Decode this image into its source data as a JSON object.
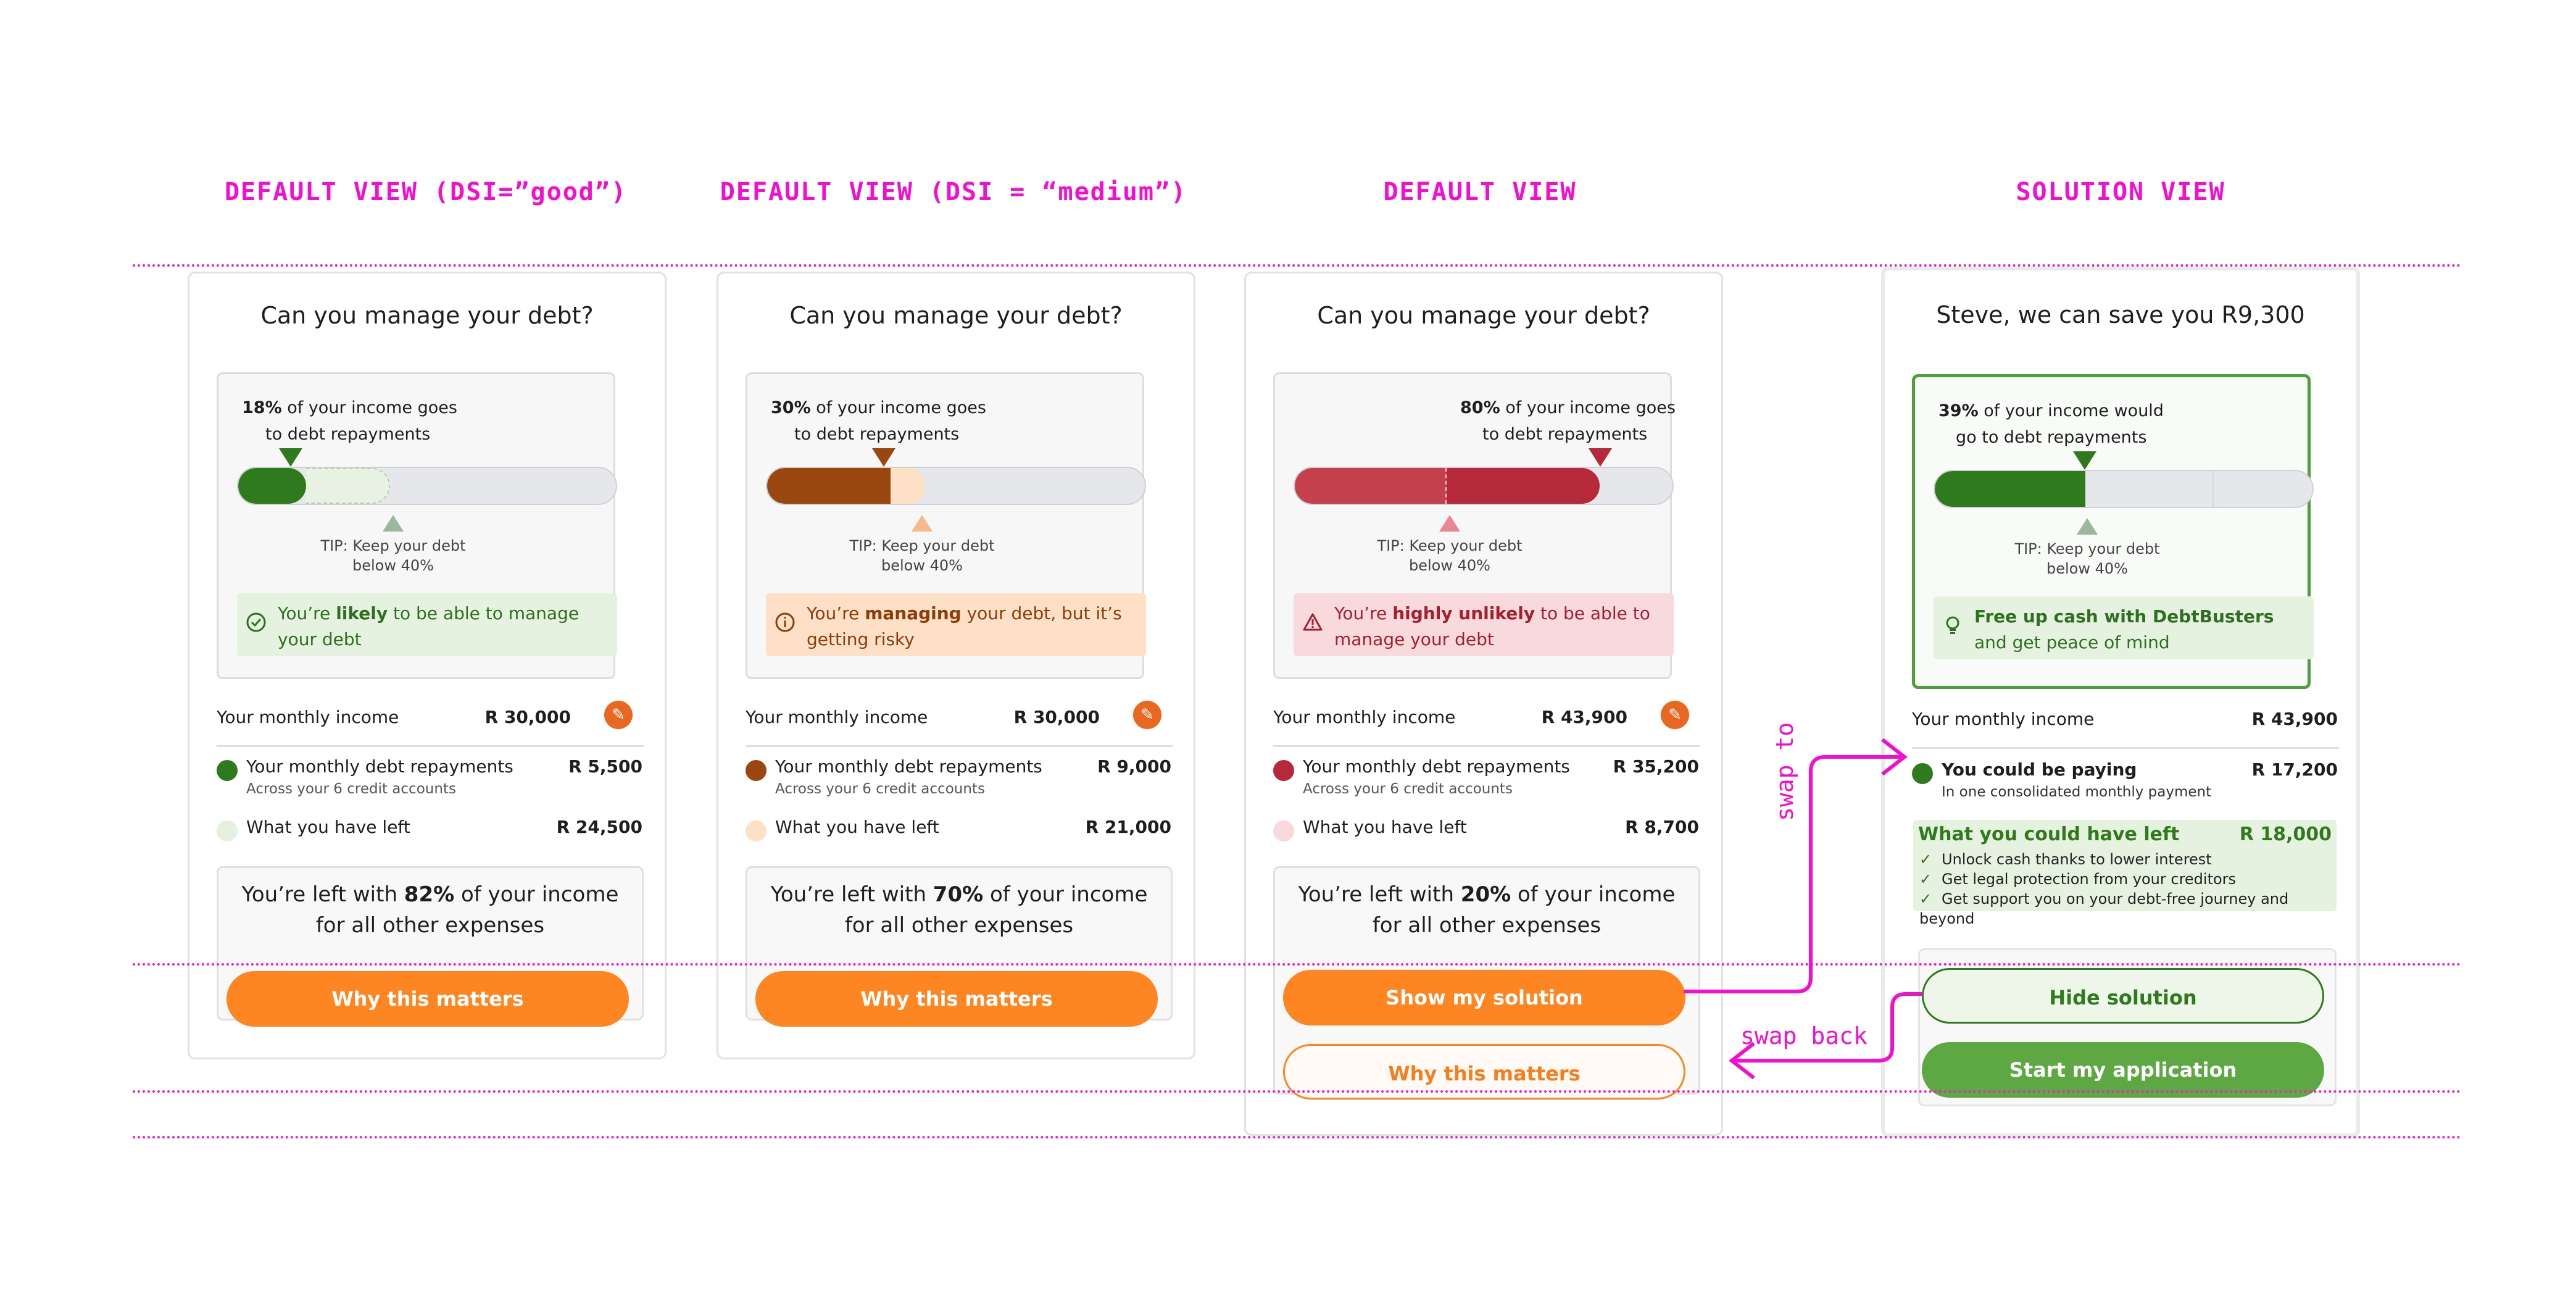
{
  "headings": [
    "DEFAULT VIEW (DSI=”good”)",
    "DEFAULT VIEW (DSI = “medium”)",
    "DEFAULT VIEW",
    "SOLUTION VIEW"
  ],
  "card1": {
    "title": "Can you manage your debt?",
    "pct": "18%",
    "pct_rest": " of your income goes",
    "pct_line2": "to debt repayments",
    "progress": 0.18,
    "tip": "TIP: Keep your debt below 40%",
    "status_pre": "You’re ",
    "status_bold": "likely",
    "status_post": " to be able to manage your debt",
    "income_label": "Your monthly income",
    "income_value": "R 30,000",
    "repay_label": "Your monthly debt repayments",
    "repay_value": "R 5,500",
    "repay_sub": "Across your 6 credit accounts",
    "left_label": "What you have left",
    "left_value": "R 24,500",
    "summary_pre": "You’re left with ",
    "summary_pct": "82%",
    "summary_post": " of your income for all other expenses",
    "button": "Why this matters"
  },
  "card2": {
    "title": "Can you manage your debt?",
    "pct": "30%",
    "pct_rest": " of your income goes",
    "pct_line2": "to debt repayments",
    "progress": 0.3,
    "tip": "TIP: Keep your debt below 40%",
    "status_pre": "You’re ",
    "status_bold": "managing",
    "status_post": " your debt, but it’s getting risky",
    "income_label": "Your monthly income",
    "income_value": "R 30,000",
    "repay_label": "Your monthly debt repayments",
    "repay_value": "R 9,000",
    "repay_sub": "Across your 6 credit accounts",
    "left_label": "What you have left",
    "left_value": "R 21,000",
    "summary_pre": "You’re left with ",
    "summary_pct": "70%",
    "summary_post": " of your income for all other expenses",
    "button": "Why this matters"
  },
  "card3": {
    "title": "Can you manage your debt?",
    "pct": "80%",
    "pct_rest": " of your income goes",
    "pct_line2": "to debt repayments",
    "progress": 0.8,
    "tip": "TIP: Keep your debt below 40%",
    "status_pre": "You’re ",
    "status_bold": "highly unlikely",
    "status_post": " to be able to manage your debt",
    "income_label": "Your monthly income",
    "income_value": "R 43,900",
    "repay_label": "Your monthly debt repayments",
    "repay_value": "R 35,200",
    "repay_sub": "Across your 6 credit accounts",
    "left_label": "What you have left",
    "left_value": "R 8,700",
    "summary_pre": "You’re left with ",
    "summary_pct": "20%",
    "summary_post": " of your income for all other expenses",
    "button_primary": "Show my solution",
    "button_secondary": "Why this matters"
  },
  "card4": {
    "title": "Steve, we can save you R9,300",
    "pct": "39%",
    "pct_rest": " of your income would",
    "pct_line2": "go to debt repayments",
    "progress": 0.39,
    "tip": "TIP: Keep your debt below 40%",
    "status_bold": "Free up cash with DebtBusters",
    "status_post": " and get peace of mind",
    "income_label": "Your monthly income",
    "income_value": "R 43,900",
    "pay_label": "You could be paying",
    "pay_value": "R 17,200",
    "pay_sub": "In one consolidated monthly payment",
    "have_left_label": "What you could have left",
    "have_left_value": "R 18,000",
    "benefits": [
      "Unlock cash thanks to lower interest",
      "Get legal protection from your creditors",
      "Get support you on your debt-free journey and beyond"
    ],
    "button_hide": "Hide solution",
    "button_start": "Start my application"
  },
  "annotations": {
    "swap_to": "swap to",
    "swap_back": "swap back"
  },
  "colors": {
    "good": "#2f7a1c",
    "medium": "#9a470f",
    "bad": "#b6293a",
    "accent": "#fd8623",
    "annotation": "#f20fd1"
  }
}
